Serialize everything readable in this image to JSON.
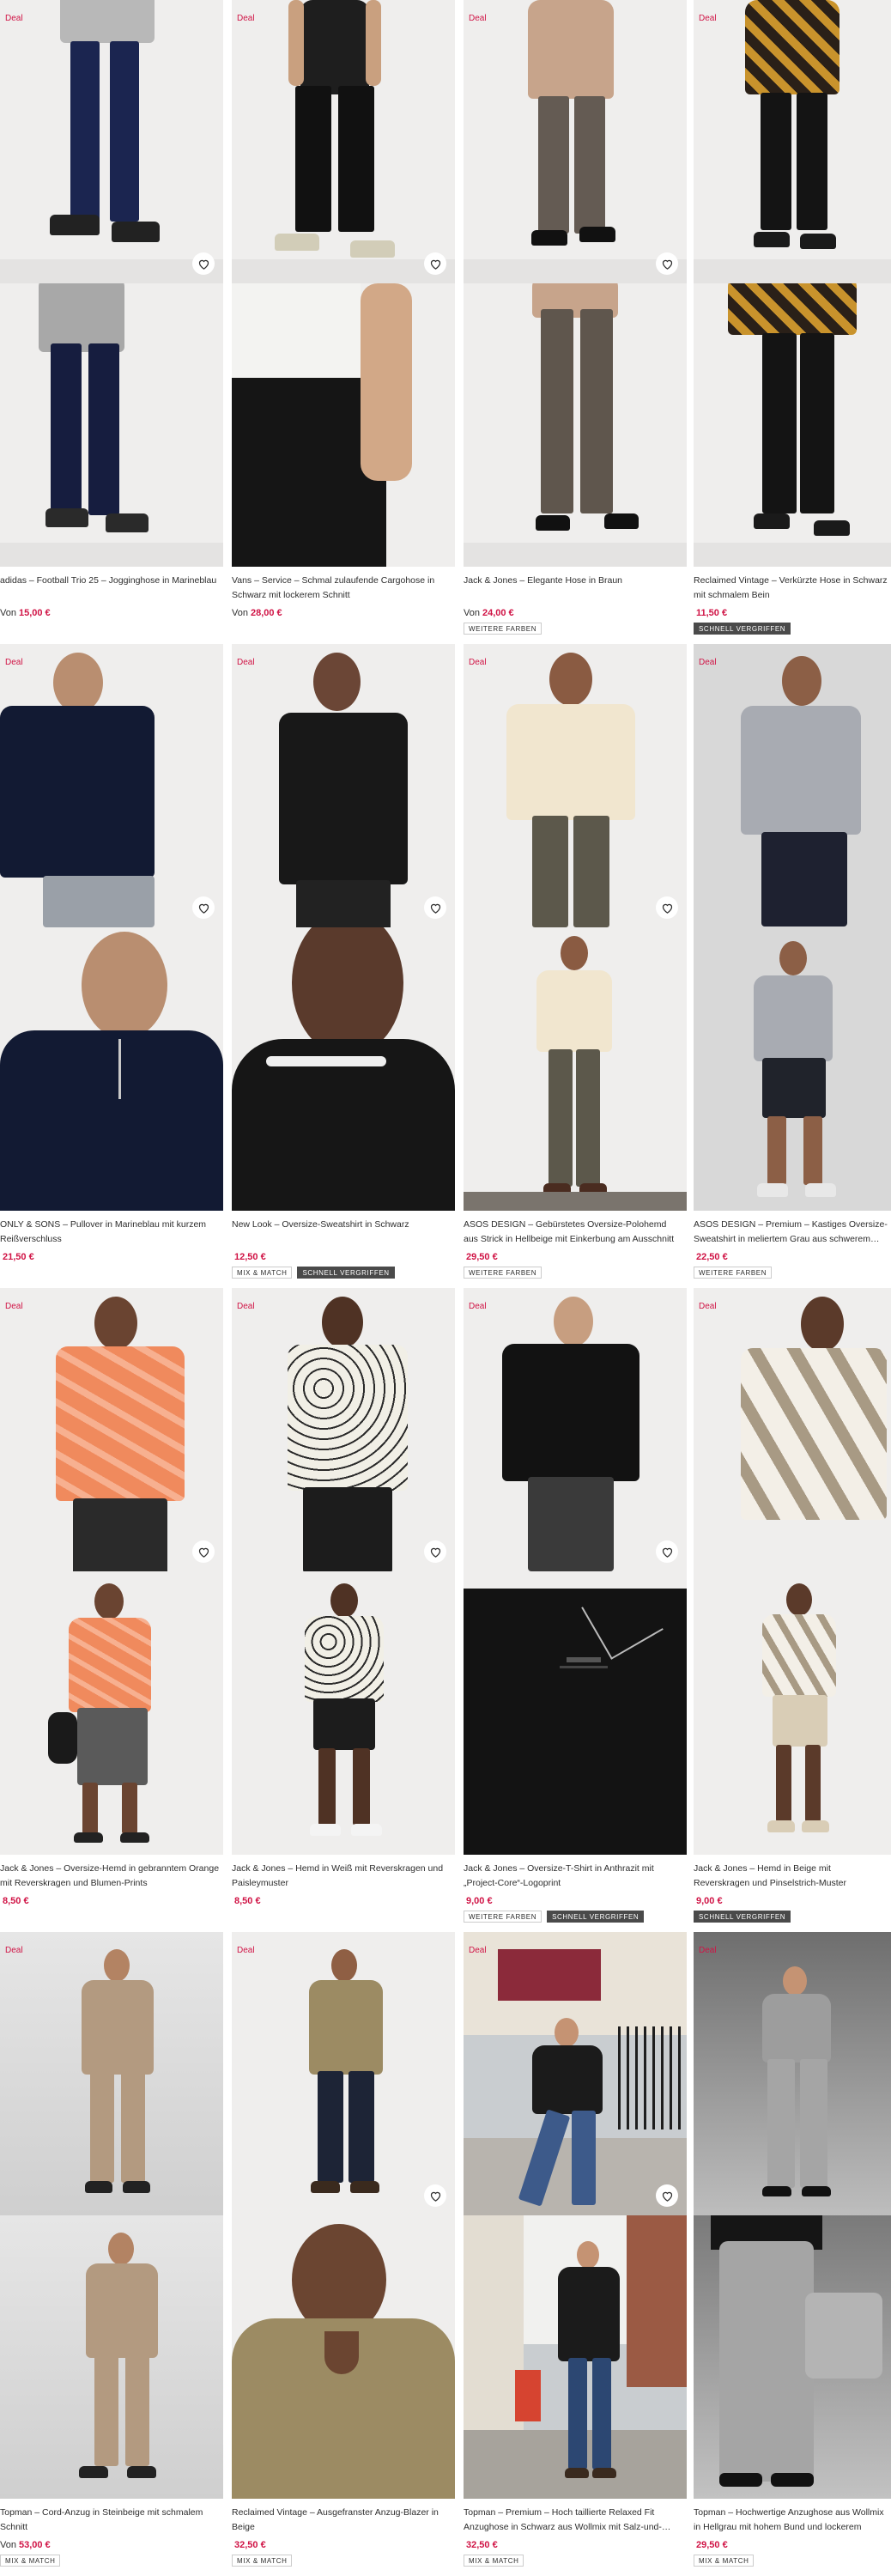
{
  "colors": {
    "accent": "#d01345",
    "text": "#2d2d2d"
  },
  "icons": {
    "wishlist": "heart-outline-icon"
  },
  "products": [
    {
      "deal": "Deal",
      "title": "adidas – Football Trio 25 – Jogginghose in Marineblau",
      "price_prefix": "Von",
      "price": "15,00 €",
      "badges": []
    },
    {
      "deal": "Deal",
      "title": "Vans – Service – Schmal zulaufende Cargohose in Schwarz mit lockerem Schnitt",
      "price_prefix": "Von",
      "price": "28,00 €",
      "badges": []
    },
    {
      "deal": "Deal",
      "title": "Jack & Jones – Elegante Hose in Braun",
      "price_prefix": "Von",
      "price": "24,00 €",
      "badges": [
        "WEITERE FARBEN"
      ]
    },
    {
      "deal": "Deal",
      "title": "Reclaimed Vintage – Verkürzte Hose in Schwarz mit schmalem Bein",
      "price_prefix": "",
      "price": "11,50 €",
      "badges": [
        "SCHNELL VERGRIFFEN"
      ]
    },
    {
      "deal": "Deal",
      "title": "ONLY & SONS – Pullover in Marineblau mit kurzem Reißverschluss",
      "price_prefix": "",
      "price": "21,50 €",
      "badges": []
    },
    {
      "deal": "Deal",
      "title": "New Look – Oversize-Sweatshirt in Schwarz",
      "price_prefix": "",
      "price": "12,50 €",
      "badges": [
        "MIX & MATCH",
        "SCHNELL VERGRIFFEN"
      ]
    },
    {
      "deal": "Deal",
      "title": "ASOS DESIGN – Gebürstetes Oversize-Polohemd aus Strick in Hellbeige mit Einkerbung am Ausschnitt",
      "price_prefix": "",
      "price": "29,50 €",
      "badges": [
        "WEITERE FARBEN"
      ]
    },
    {
      "deal": "Deal",
      "title": "ASOS DESIGN – Premium – Kastiges Oversize-Sweatshirt in meliertem Grau aus schwerem…",
      "price_prefix": "",
      "price": "22,50 €",
      "badges": [
        "WEITERE FARBEN"
      ]
    },
    {
      "deal": "Deal",
      "title": "Jack & Jones – Oversize-Hemd in gebranntem Orange mit Reverskragen und Blumen-Prints",
      "price_prefix": "",
      "price": "8,50 €",
      "badges": []
    },
    {
      "deal": "Deal",
      "title": "Jack & Jones – Hemd in Weiß mit Reverskragen und Paisleymuster",
      "price_prefix": "",
      "price": "8,50 €",
      "badges": []
    },
    {
      "deal": "Deal",
      "title": "Jack & Jones – Oversize-T-Shirt in Anthrazit mit „Project-Core“-Logoprint",
      "price_prefix": "",
      "price": "9,00 €",
      "badges": [
        "WEITERE FARBEN",
        "SCHNELL VERGRIFFEN"
      ]
    },
    {
      "deal": "Deal",
      "title": "Jack & Jones – Hemd in Beige mit Reverskragen und Pinselstrich-Muster",
      "price_prefix": "",
      "price": "9,00 €",
      "badges": [
        "SCHNELL VERGRIFFEN"
      ]
    },
    {
      "deal": "Deal",
      "title": "Topman – Cord-Anzug in Steinbeige mit schmalem Schnitt",
      "price_prefix": "Von",
      "price": "53,00 €",
      "badges": [
        "MIX & MATCH"
      ]
    },
    {
      "deal": "Deal",
      "title": "Reclaimed Vintage – Ausgefranster Anzug-Blazer in Beige",
      "price_prefix": "",
      "price": "32,50 €",
      "badges": [
        "MIX & MATCH"
      ]
    },
    {
      "deal": "Deal",
      "title": "Topman – Premium – Hoch taillierte Relaxed Fit Anzughose in Schwarz aus Wollmix mit Salz-und-…",
      "price_prefix": "",
      "price": "32,50 €",
      "badges": [
        "MIX & MATCH"
      ]
    },
    {
      "deal": "Deal",
      "title": "Topman – Hochwertige Anzughose aus Wollmix in Hellgrau mit hohem Bund und lockerem Schnitt",
      "price_prefix": "",
      "price": "29,50 €",
      "badges": [
        "MIX & MATCH"
      ]
    }
  ]
}
